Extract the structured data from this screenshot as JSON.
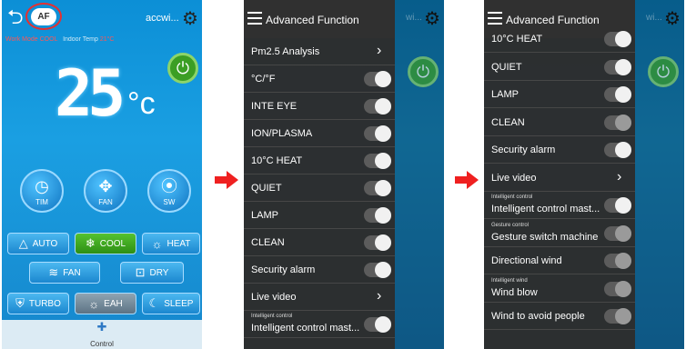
{
  "phone1": {
    "af_label": "AF",
    "device_name": "accwi...",
    "status_mode_label": "Work Mode",
    "status_mode_value": "COOL",
    "status_temp_label": "Indoor Temp",
    "status_temp_value": "21°C",
    "temperature": "25",
    "unit": "°c",
    "round_buttons": [
      "TIM",
      "FAN",
      "SW"
    ],
    "modes_row1": [
      "AUTO",
      "COOL",
      "HEAT"
    ],
    "modes_row2": [
      "FAN",
      "DRY"
    ],
    "modes_row3": [
      "TURBO",
      "EAH",
      "SLEEP"
    ],
    "footer_label": "Control",
    "colors": {
      "accent_green": "#3b9e24",
      "status_red": "#ff5656",
      "bg_blue": "#1a9fe2"
    }
  },
  "phone2": {
    "title": "Advanced Function",
    "items": [
      {
        "label": "Pm2.5 Analysis",
        "type": "chevron"
      },
      {
        "label": "°C/°F",
        "type": "toggle"
      },
      {
        "label": "INTE EYE",
        "type": "toggle"
      },
      {
        "label": "ION/PLASMA",
        "type": "toggle"
      },
      {
        "label": "10°C HEAT",
        "type": "toggle"
      },
      {
        "label": "QUIET",
        "type": "toggle"
      },
      {
        "label": "LAMP",
        "type": "toggle"
      },
      {
        "label": "CLEAN",
        "type": "toggle"
      },
      {
        "label": "Security alarm",
        "type": "toggle"
      },
      {
        "label": "Live video",
        "type": "chevron"
      },
      {
        "label": "Intelligent control mast...",
        "sublabel": "Intelligent control",
        "type": "toggle"
      }
    ]
  },
  "phone3": {
    "title": "Advanced Function",
    "items": [
      {
        "label": "10°C HEAT",
        "type": "toggle"
      },
      {
        "label": "QUIET",
        "type": "toggle"
      },
      {
        "label": "LAMP",
        "type": "toggle"
      },
      {
        "label": "CLEAN",
        "type": "toggle",
        "disabled": true
      },
      {
        "label": "Security alarm",
        "type": "toggle"
      },
      {
        "label": "Live video",
        "type": "chevron"
      },
      {
        "label": "Intelligent control mast...",
        "sublabel": "Intelligent control",
        "type": "toggle"
      },
      {
        "label": "Gesture switch machine",
        "sublabel": "Gesture control",
        "type": "toggle",
        "disabled": true
      },
      {
        "label": "Directional wind",
        "type": "toggle",
        "disabled": true
      },
      {
        "label": "Wind blow",
        "sublabel": "Intelligent wind",
        "type": "toggle",
        "disabled": true
      },
      {
        "label": "Wind to avoid people",
        "type": "toggle",
        "disabled": true
      }
    ]
  }
}
